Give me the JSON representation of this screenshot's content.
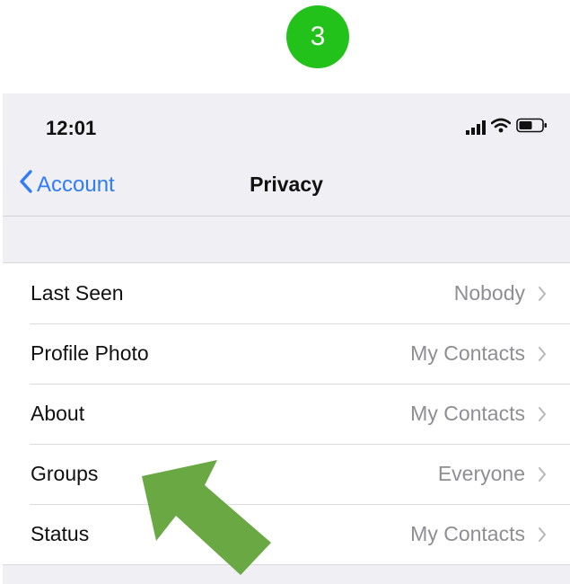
{
  "step_badge": "3",
  "status_bar": {
    "time": "12:01",
    "icons": [
      "cellular-signal-icon",
      "wifi-icon",
      "battery-icon"
    ]
  },
  "nav": {
    "back_label": "Account",
    "title": "Privacy"
  },
  "rows": [
    {
      "label": "Last Seen",
      "value": "Nobody"
    },
    {
      "label": "Profile Photo",
      "value": "My Contacts"
    },
    {
      "label": "About",
      "value": "My Contacts"
    },
    {
      "label": "Groups",
      "value": "Everyone"
    },
    {
      "label": "Status",
      "value": "My Contacts"
    }
  ],
  "colors": {
    "badge": "#22c21a",
    "link": "#2f7cf6",
    "arrow": "#6aa843",
    "background": "#efeff4"
  }
}
